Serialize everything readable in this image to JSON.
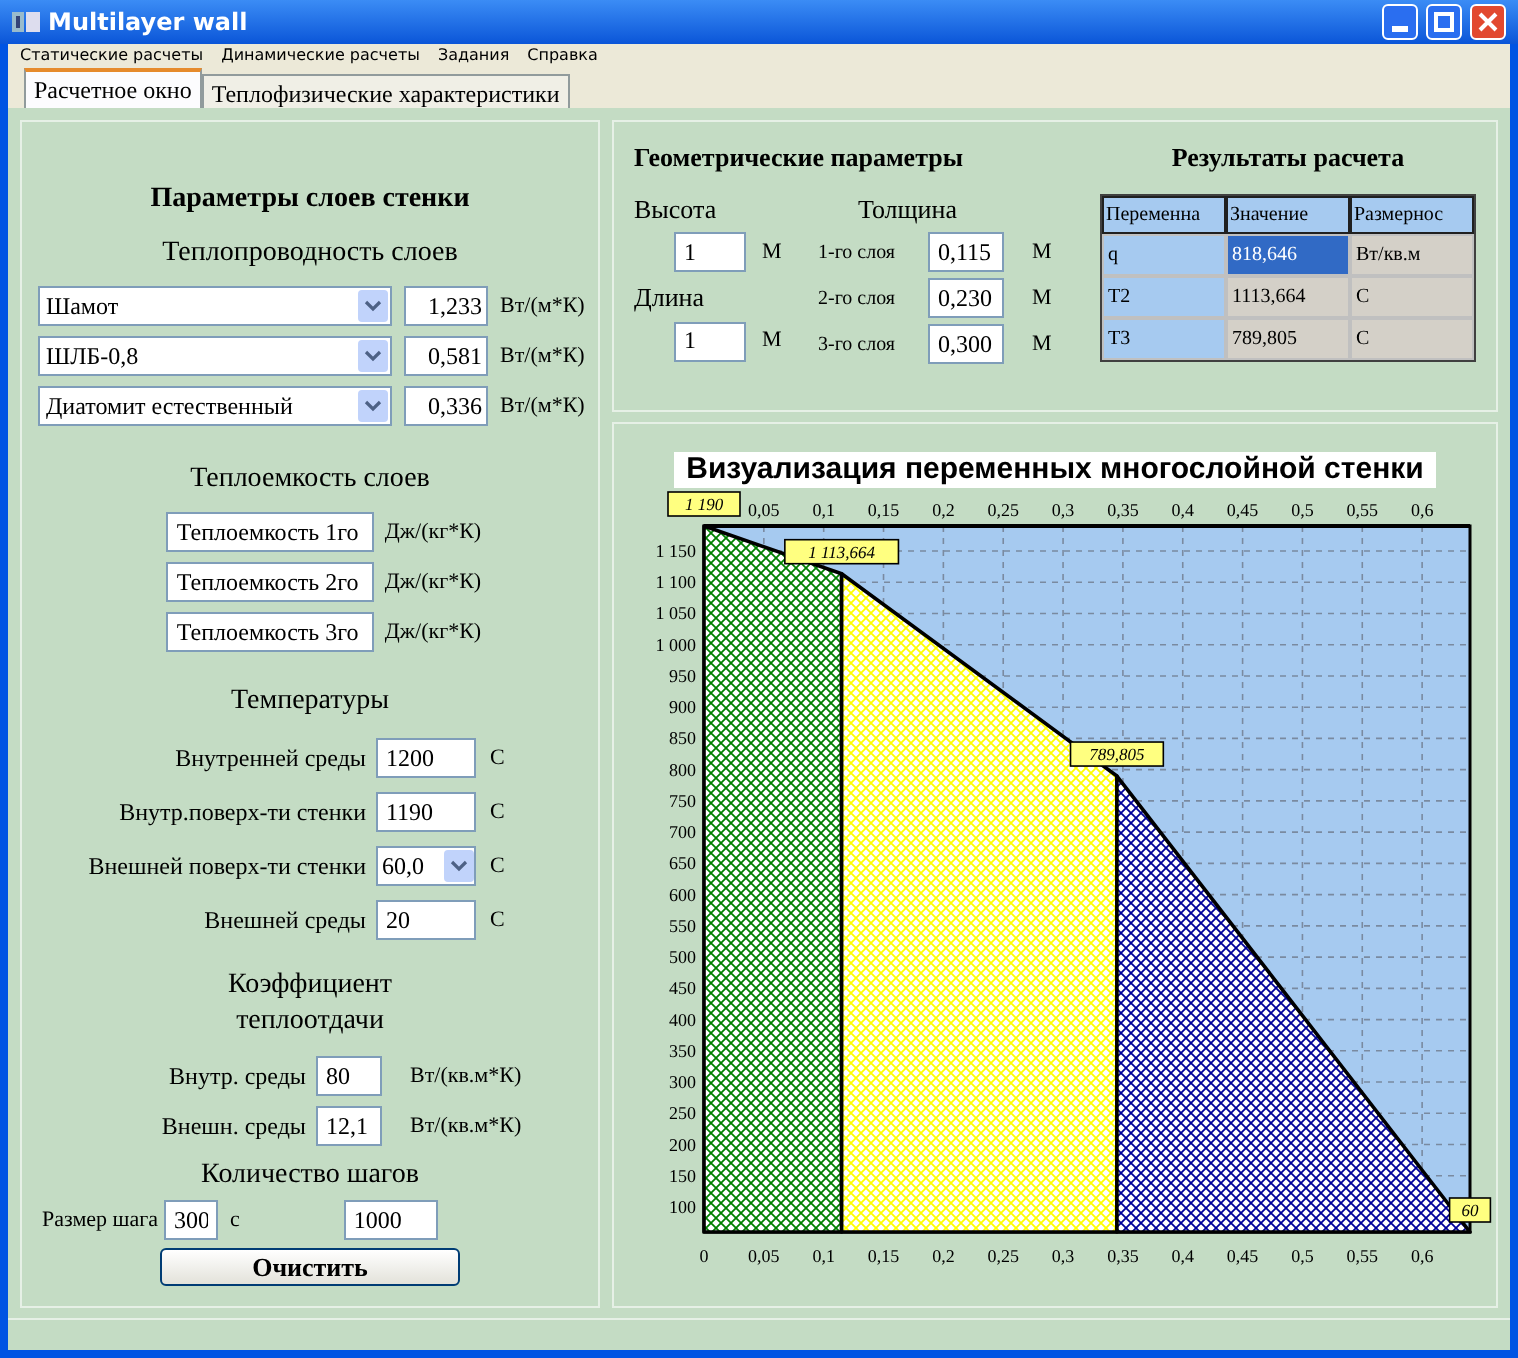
{
  "window": {
    "title": "Multilayer wall"
  },
  "menu": [
    "Статические расчеты",
    "Динамические расчеты",
    "Задания",
    "Справка"
  ],
  "tabs": [
    {
      "label": "Расчетное окно",
      "selected": true
    },
    {
      "label": "Теплофизические характеристики",
      "selected": false
    }
  ],
  "layers_panel": {
    "title": "Параметры слоев стенки",
    "conductivity": {
      "title": "Теплопроводность слоев",
      "rows": [
        {
          "material": "Шамот",
          "value": "1,233",
          "unit": "Вт/(м*К)"
        },
        {
          "material": "ШЛБ-0,8",
          "value": "0,581",
          "unit": "Вт/(м*К)"
        },
        {
          "material": "Диатомит естественный",
          "value": "0,336",
          "unit": "Вт/(м*К)"
        }
      ]
    },
    "heat_capacity": {
      "title": "Теплоемкость слоев",
      "rows": [
        {
          "value": "Теплоемкость 1го",
          "unit": "Дж/(кг*К)"
        },
        {
          "value": "Теплоемкость 2го",
          "unit": "Дж/(кг*К)"
        },
        {
          "value": "Теплоемкость 3го",
          "unit": "Дж/(кг*К)"
        }
      ]
    },
    "temperatures": {
      "title": "Температуры",
      "rows": [
        {
          "kind": "text",
          "label": "Внутренней среды",
          "value": "1200",
          "unit": "C"
        },
        {
          "kind": "text",
          "label": "Внутр.поверх-ти стенки",
          "value": "1190",
          "unit": "C"
        },
        {
          "kind": "combo",
          "label": "Внешней поверх-ти стенки",
          "value": "60,0",
          "unit": "C"
        },
        {
          "kind": "text",
          "label": "Внешней среды",
          "value": "20",
          "unit": "C"
        }
      ]
    },
    "heat_transfer": {
      "title": "Коэффициент теплоотдачи",
      "rows": [
        {
          "label": "Внутр. среды",
          "value": "80",
          "unit": "Вт/(кв.м*К)"
        },
        {
          "label": "Внешн. среды",
          "value": "12,1",
          "unit": "Вт/(кв.м*К)"
        }
      ]
    },
    "steps": {
      "title": "Количество шагов",
      "label": "Размер шага",
      "step": "300",
      "step_unit": "с",
      "count": "1000"
    },
    "clear_button": "Очистить"
  },
  "geometry": {
    "title": "Геометрические параметры",
    "height": {
      "label": "Высота",
      "value": "1",
      "unit": "М"
    },
    "length": {
      "label": "Длина",
      "value": "1",
      "unit": "М"
    },
    "thickness": {
      "title": "Толщина",
      "rows": [
        {
          "label": "1-го слоя",
          "value": "0,115",
          "unit": "М"
        },
        {
          "label": "2-го слоя",
          "value": "0,230",
          "unit": "М"
        },
        {
          "label": "3-го слоя",
          "value": "0,300",
          "unit": "М"
        }
      ]
    }
  },
  "results": {
    "title": "Результаты расчета",
    "columns": [
      "Переменна",
      "Значение",
      "Размернос"
    ],
    "rows": [
      {
        "cells": [
          "q",
          "818,646",
          "Вт/кв.м"
        ],
        "selected": true
      },
      {
        "cells": [
          "T2",
          "1113,664",
          "C"
        ],
        "selected": false
      },
      {
        "cells": [
          "T3",
          "789,805",
          "C"
        ],
        "selected": false
      }
    ]
  },
  "chart": {
    "chart_data": {
      "type": "area",
      "grid": true,
      "title": "Визуализация переменных многослойной стенки",
      "x": [
        0,
        0.115,
        0.345,
        0.64
      ],
      "series": [
        {
          "color": "#008000",
          "values": [
            1190,
            1113.664,
            null,
            null
          ]
        },
        {
          "color": "#ffff00",
          "values": [
            null,
            1113.664,
            789.805,
            null
          ]
        },
        {
          "color": "#000099",
          "values": [
            null,
            null,
            789.805,
            60
          ]
        }
      ],
      "xlim": [
        0,
        0.64
      ],
      "ylim": [
        60,
        1190
      ],
      "xticks": [
        {
          "value": 0,
          "label": "0"
        },
        {
          "value": 0.05,
          "label": "0,05"
        },
        {
          "value": 0.1,
          "label": "0,1"
        },
        {
          "value": 0.15,
          "label": "0,15"
        },
        {
          "value": 0.2,
          "label": "0,2"
        },
        {
          "value": 0.25,
          "label": "0,25"
        },
        {
          "value": 0.3,
          "label": "0,3"
        },
        {
          "value": 0.35,
          "label": "0,35"
        },
        {
          "value": 0.4,
          "label": "0,4"
        },
        {
          "value": 0.45,
          "label": "0,45"
        },
        {
          "value": 0.5,
          "label": "0,5"
        },
        {
          "value": 0.55,
          "label": "0,55"
        },
        {
          "value": 0.6,
          "label": "0,6"
        }
      ],
      "yticks": [
        100,
        150,
        200,
        250,
        300,
        350,
        400,
        450,
        500,
        550,
        600,
        650,
        700,
        750,
        800,
        850,
        900,
        950,
        {
          "value": 1000,
          "label": "1 000"
        },
        {
          "value": 1050,
          "label": "1 050"
        },
        {
          "value": 1100,
          "label": "1 100"
        },
        {
          "value": 1150,
          "label": "1 150"
        }
      ],
      "value_labels": [
        "1 190",
        "1 113,664",
        "789,805",
        "60"
      ]
    }
  }
}
